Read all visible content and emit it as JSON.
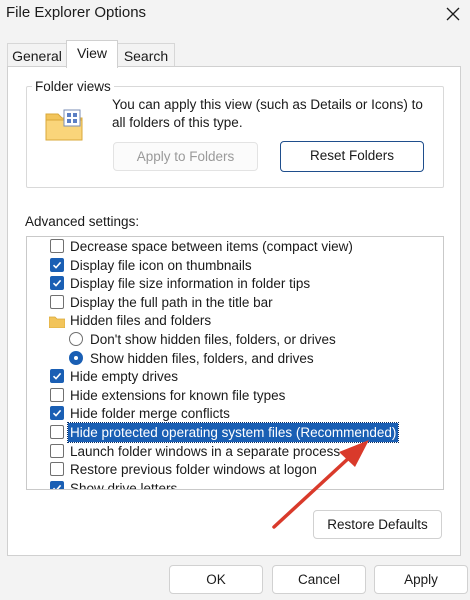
{
  "window": {
    "title": "File Explorer Options"
  },
  "tabs": [
    {
      "label": "General",
      "active": false
    },
    {
      "label": "View",
      "active": true
    },
    {
      "label": "Search",
      "active": false
    }
  ],
  "folder_views": {
    "legend": "Folder views",
    "description": "You can apply this view (such as Details or Icons) to all folders of this type.",
    "apply_button": "Apply to Folders",
    "reset_button": "Reset Folders"
  },
  "advanced": {
    "label": "Advanced settings:",
    "items": [
      {
        "type": "checkbox",
        "label": "Decrease space between items (compact view)",
        "checked": false
      },
      {
        "type": "checkbox",
        "label": "Display file icon on thumbnails",
        "checked": true
      },
      {
        "type": "checkbox",
        "label": "Display file size information in folder tips",
        "checked": true
      },
      {
        "type": "checkbox",
        "label": "Display the full path in the title bar",
        "checked": false
      },
      {
        "type": "folder",
        "label": "Hidden files and folders"
      },
      {
        "type": "radio",
        "label": "Don't show hidden files, folders, or drives",
        "checked": false
      },
      {
        "type": "radio",
        "label": "Show hidden files, folders, and drives",
        "checked": true
      },
      {
        "type": "checkbox",
        "label": "Hide empty drives",
        "checked": true
      },
      {
        "type": "checkbox",
        "label": "Hide extensions for known file types",
        "checked": false
      },
      {
        "type": "checkbox",
        "label": "Hide folder merge conflicts",
        "checked": true
      },
      {
        "type": "checkbox",
        "label": "Hide protected operating system files (Recommended)",
        "checked": false,
        "selected": true
      },
      {
        "type": "checkbox",
        "label": "Launch folder windows in a separate process",
        "checked": false
      },
      {
        "type": "checkbox",
        "label": "Restore previous folder windows at logon",
        "checked": false
      },
      {
        "type": "checkbox",
        "label": "Show drive letters",
        "checked": true
      }
    ]
  },
  "restore_defaults_button": "Restore Defaults",
  "footer": {
    "ok": "OK",
    "cancel": "Cancel",
    "apply": "Apply"
  },
  "colors": {
    "accent": "#1a5fb4",
    "annotation_arrow": "#d93a2b",
    "window_bg": "#f3f3f3"
  }
}
